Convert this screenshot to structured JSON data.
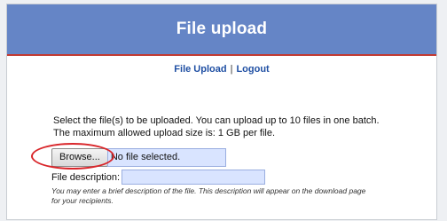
{
  "header": {
    "title": "File upload"
  },
  "nav": {
    "upload_link": "File Upload",
    "separator": "|",
    "logout_link": "Logout"
  },
  "intro": {
    "line1": "Select the file(s) to be uploaded. You can upload up to 10 files in one batch.",
    "line2": "The maximum allowed upload size is: 1 GB per file."
  },
  "file_input": {
    "browse_label": "Browse...",
    "status_text": "No file selected."
  },
  "description": {
    "label": "File description:",
    "value": "",
    "hint_line1": "You may enter a brief description of the file. This description will appear on the download page",
    "hint_line2": "for your recipients."
  },
  "colors": {
    "header_bg": "#6585c6",
    "header_rule": "#c23a32",
    "link": "#1f4fa3",
    "input_bg": "#d9e4ff",
    "annotation": "#d9262a"
  }
}
